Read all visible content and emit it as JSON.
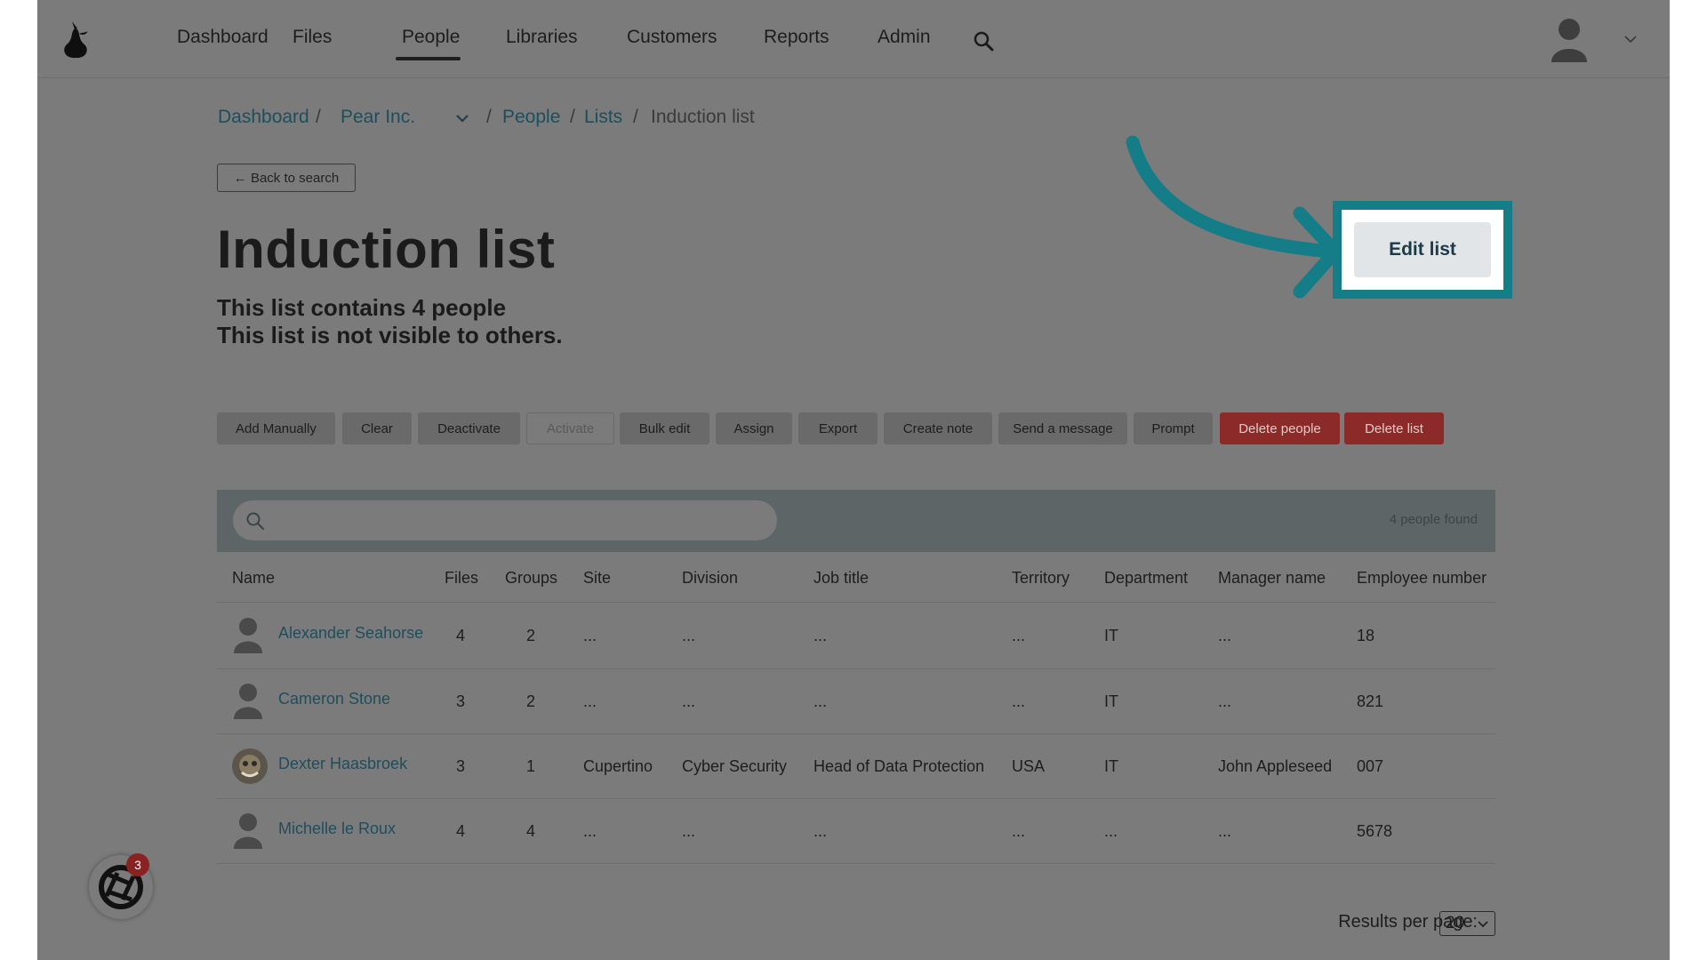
{
  "nav": {
    "items": [
      "Dashboard",
      "Files",
      "People",
      "Libraries",
      "Customers",
      "Reports",
      "Admin"
    ],
    "active": "People"
  },
  "breadcrumb": {
    "dashboard": "Dashboard",
    "sep1": "/",
    "org": "Pear Inc.",
    "sep2": "/",
    "people": "People",
    "sep3": "/",
    "lists": "Lists",
    "sep4": "/",
    "current": "Induction list"
  },
  "back_button": "← Back to search",
  "page": {
    "title": "Induction list",
    "count_line": "This list contains 4 people",
    "visibility_line": "This list is not visible to others."
  },
  "edit_button": "Edit list",
  "actions": [
    {
      "label": "Add Manually",
      "state": "normal"
    },
    {
      "label": "Clear",
      "state": "normal"
    },
    {
      "label": "Deactivate",
      "state": "normal"
    },
    {
      "label": "Activate",
      "state": "disabled"
    },
    {
      "label": "Bulk edit",
      "state": "normal"
    },
    {
      "label": "Assign",
      "state": "normal"
    },
    {
      "label": "Export",
      "state": "normal"
    },
    {
      "label": "Create note",
      "state": "normal"
    },
    {
      "label": "Send a message",
      "state": "normal"
    },
    {
      "label": "Prompt",
      "state": "normal"
    },
    {
      "label": "Delete people",
      "state": "danger"
    },
    {
      "label": "Delete list",
      "state": "danger"
    }
  ],
  "search": {
    "placeholder": "",
    "found": "4 people found"
  },
  "table": {
    "columns": [
      "Name",
      "Files",
      "Groups",
      "Site",
      "Division",
      "Job title",
      "Territory",
      "Department",
      "Manager name",
      "Employee number"
    ],
    "rows": [
      {
        "name": "Alexander Seahorse",
        "files": "4",
        "groups": "2",
        "site": "...",
        "division": "...",
        "job_title": "...",
        "territory": "...",
        "department": "IT",
        "manager": "...",
        "employee_number": "18",
        "avatar": "default"
      },
      {
        "name": "Cameron Stone",
        "files": "3",
        "groups": "2",
        "site": "...",
        "division": "...",
        "job_title": "...",
        "territory": "...",
        "department": "IT",
        "manager": "...",
        "employee_number": "821",
        "avatar": "default"
      },
      {
        "name": "Dexter Haasbroek",
        "files": "3",
        "groups": "1",
        "site": "Cupertino",
        "division": "Cyber Security",
        "job_title": "Head of Data Protection",
        "territory": "USA",
        "department": "IT",
        "manager": "John Appleseed",
        "employee_number": "007",
        "avatar": "photo"
      },
      {
        "name": "Michelle le Roux",
        "files": "4",
        "groups": "4",
        "site": "...",
        "division": "...",
        "job_title": "...",
        "territory": "...",
        "department": "...",
        "manager": "...",
        "employee_number": "5678",
        "avatar": "default"
      }
    ]
  },
  "pagination": {
    "label": "Results per page:",
    "value": "20"
  },
  "notifications": {
    "count": "3"
  },
  "colors": {
    "accent": "#147d87",
    "danger": "#8c2a2a",
    "link": "#1e4e5d",
    "overlay_bg": "#7b7b7b"
  }
}
